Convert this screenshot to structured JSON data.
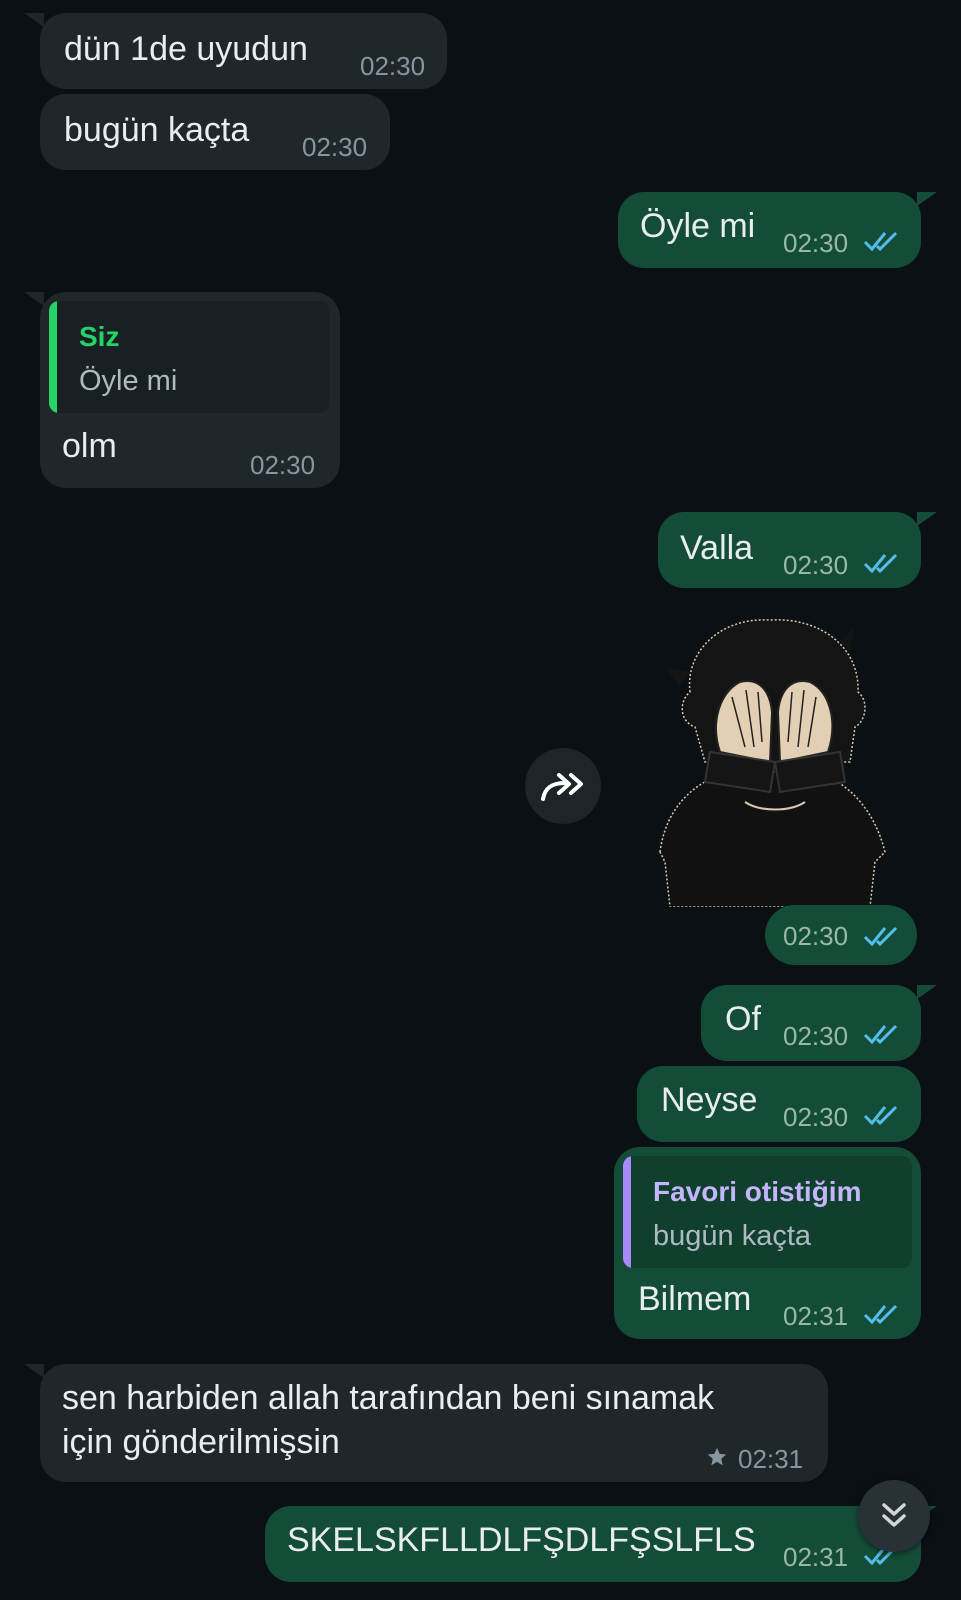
{
  "messages": [
    {
      "text": "dün 1de uyudun",
      "time": "02:30"
    },
    {
      "text": "bugün kaçta",
      "time": "02:30"
    },
    {
      "text": "Öyle mi",
      "time": "02:30"
    },
    {
      "quote_name": "Siz",
      "quote_text": "Öyle mi",
      "text": "olm",
      "time": "02:30"
    },
    {
      "text": "Valla",
      "time": "02:30"
    },
    {
      "sticker": "anime-boy-covering-face",
      "time": "02:30"
    },
    {
      "text": "Of",
      "time": "02:30"
    },
    {
      "text": "Neyse",
      "time": "02:30"
    },
    {
      "quote_name": "Favori otistiğim",
      "quote_text": "bugün kaçta",
      "text": "Bilmem",
      "time": "02:31"
    },
    {
      "text_line1": "sen harbiden allah tarafından beni sınamak",
      "text_line2": "için gönderilmişsin",
      "time": "02:31",
      "starred": true
    },
    {
      "text": "SKELSKFLLDLFŞDLFŞSLFLS",
      "time": "02:31"
    }
  ],
  "icons": {
    "forward": "forward-icon",
    "scroll_down": "double-chevron-down-icon",
    "read_receipt": "double-check-icon",
    "star": "star-icon"
  },
  "colors": {
    "background": "#0b1014",
    "incoming": "#1f272b",
    "outgoing": "#144d37",
    "read_tick": "#53bdeb",
    "quote_siz": "#25d366",
    "quote_favori": "#a78bfa"
  }
}
